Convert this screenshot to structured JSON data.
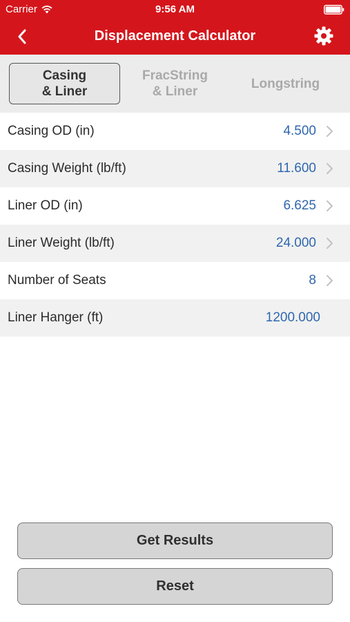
{
  "status_bar": {
    "carrier": "Carrier",
    "time": "9:56 AM"
  },
  "nav": {
    "title": "Displacement Calculator",
    "back_icon": "chevron-left-icon",
    "settings_icon": "gear-icon",
    "bar_color": "#d4161c"
  },
  "tabs": [
    {
      "label": "Casing\n& Liner",
      "active": true
    },
    {
      "label": "FracString\n& Liner",
      "active": false
    },
    {
      "label": "Longstring",
      "active": false
    }
  ],
  "rows": [
    {
      "label": "Casing OD (in)",
      "value": "4.500",
      "chevron": true
    },
    {
      "label": "Casing Weight (lb/ft)",
      "value": "11.600",
      "chevron": true
    },
    {
      "label": "Liner OD (in)",
      "value": "6.625",
      "chevron": true
    },
    {
      "label": "Liner Weight (lb/ft)",
      "value": "24.000",
      "chevron": true
    },
    {
      "label": "Number of Seats",
      "value": "8",
      "chevron": true
    },
    {
      "label": "Liner Hanger (ft)",
      "value": "1200.000",
      "chevron": false
    }
  ],
  "actions": {
    "get_results": "Get Results",
    "reset": "Reset"
  },
  "colors": {
    "value_text": "#2f67ae",
    "row_alt": "#f1f1f1",
    "segment_bg": "#ececec"
  }
}
